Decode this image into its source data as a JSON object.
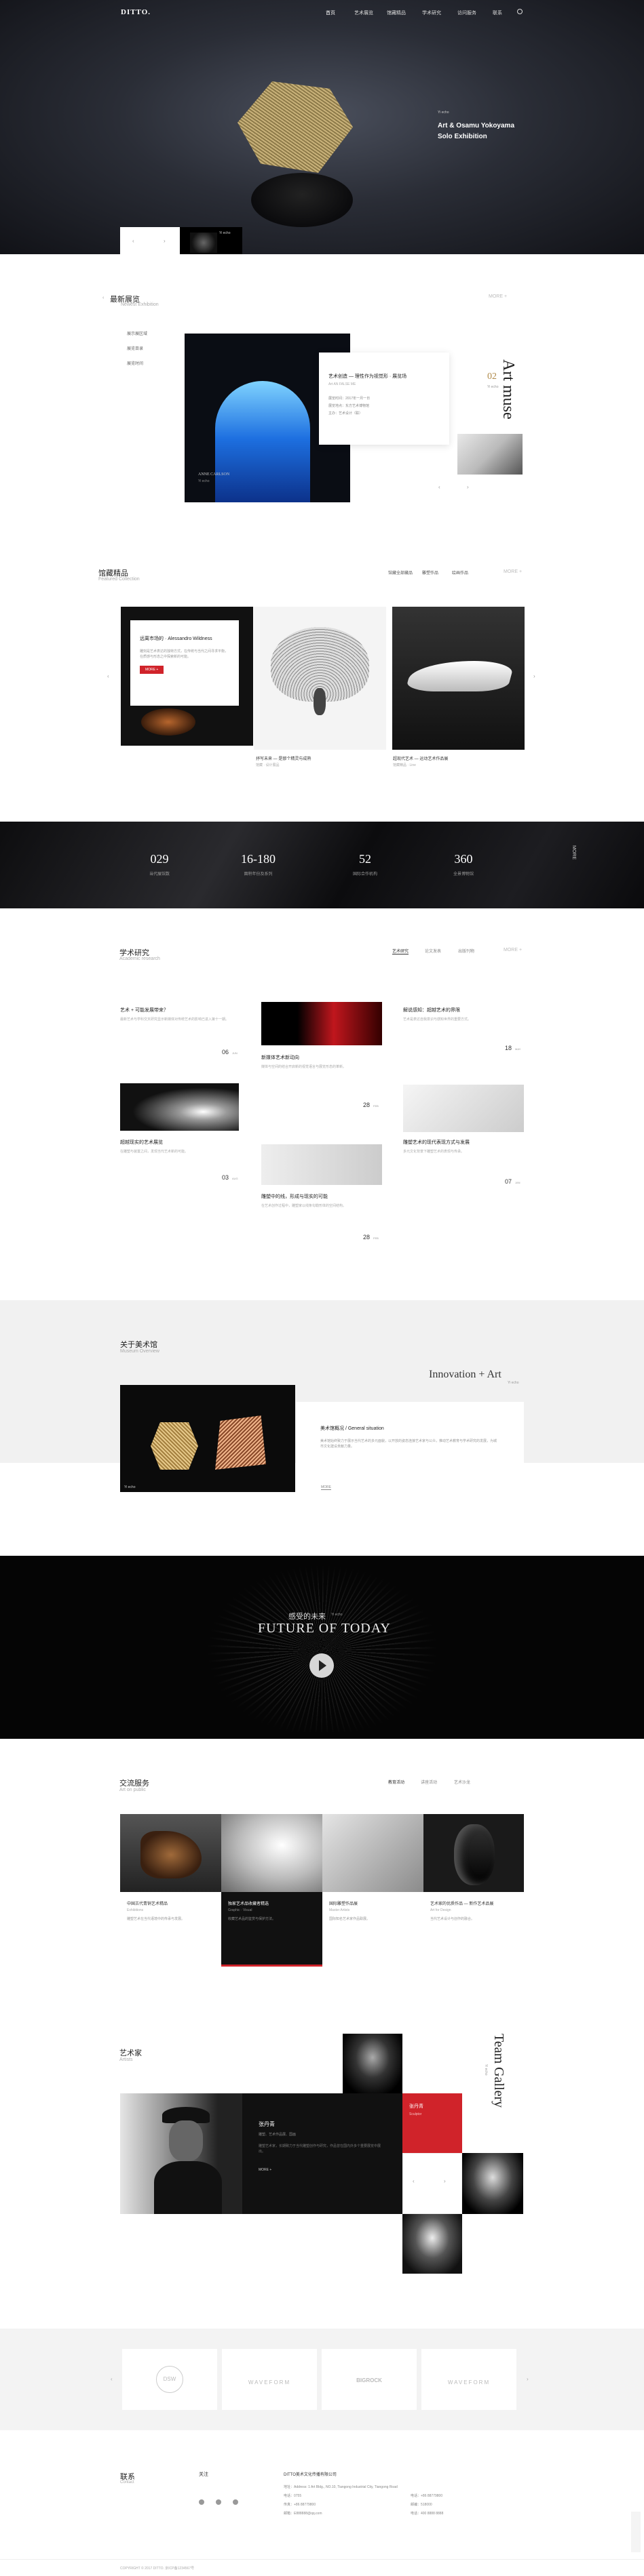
{
  "brand": {
    "logo": "DITTO."
  },
  "nav": {
    "items": [
      "首页",
      "艺术展览",
      "馆藏精品",
      "学术研究",
      "访问服务",
      "联系"
    ],
    "search_icon": "search-icon"
  },
  "hero": {
    "label": "Yi echo",
    "title_line1": "Art & Osamu Yokoyama",
    "title_line2": "Solo Exhibition",
    "thumb_label": "Yi echo"
  },
  "latest": {
    "title": "最新展览",
    "subtitle": "Newest Exhibition",
    "more": "MORE +",
    "list": [
      "展示展区域",
      "展览目录",
      "展览时间"
    ],
    "image_caption1": "ANNE CARLSON",
    "image_caption2": "Yi echo",
    "card_title": "艺术创造 — 理性作为视觉形 · 展览场",
    "card_sub": "Art AN FALSE ME",
    "card_info1": "展览时间：2017年一月一日",
    "card_info2": "展览地点：东方艺术博物馆",
    "card_info3": "主办：艺术设计（联）",
    "muse_title": "Art muse",
    "muse_num": "02",
    "muse_small": "Yi echo"
  },
  "collection": {
    "title": "馆藏精品",
    "subtitle": "Featured Collection",
    "tabs": [
      "馆藏全部藏品",
      "雕塑作品",
      "绘画作品"
    ],
    "more": "MORE +",
    "card1_title": "远离市场的 · Alessandro Wildness",
    "card1_desc": "雕刻是艺术表达的独特方式，在传统与当代之间寻求平衡，在质感与形态之中探索新的可能。",
    "card1_btn": "MORE +",
    "card2_title": "抒写未来 — 是那个精灵与成熟",
    "card2_sub": "馆藏 · 设计展品",
    "card3_title": "超现代艺术 — 运动艺术作品展",
    "card3_sub": "馆藏精品 · Line"
  },
  "stats": [
    {
      "num": "029",
      "label": "当代展馆数"
    },
    {
      "num": "16-180",
      "label": "面积年份及系列"
    },
    {
      "num": "52",
      "label": "国际合作机构"
    },
    {
      "num": "360",
      "label": "全景博物馆"
    }
  ],
  "stats_side": "MORE",
  "research": {
    "title": "学术研究",
    "subtitle": "Academic research",
    "tabs": [
      "艺术研究",
      "论文发表",
      "出版刊物"
    ],
    "more": "MORE +",
    "items": [
      {
        "title": "艺术 + 可能发展带来？",
        "desc": "最新艺术与学科交叉研究显示新媒体对传统艺术的影响已进入第十一期。",
        "date": "06",
        "unit": "JUN"
      },
      {
        "title": "新媒体艺术新动向",
        "desc": "媒体与空间的结合开启新的视觉语言与展览形态的革新。",
        "date": "28",
        "unit": "FEB"
      },
      {
        "title": "解说感知：超越艺术的界限",
        "desc": "艺术是表达自我意识与感知世界的重要方式。",
        "date": "18",
        "unit": "MAY"
      },
      {
        "title": "超越现实的艺术展览",
        "desc": "在雕塑与装置之间，发现当代艺术新的可能。",
        "date": "03",
        "unit": "AUG"
      },
      {
        "title": "雕塑中的线，形成与现实的可能",
        "desc": "在艺术创作过程中，雕塑家以线条勾勒形体的空间结构。",
        "date": "28",
        "unit": "FEB"
      },
      {
        "title": "雕塑艺术的现代表现方式与发展",
        "desc": "多元文化背景下雕塑艺术的表现与传承。",
        "date": "07",
        "unit": "JAN"
      }
    ]
  },
  "about": {
    "title": "关于美术馆",
    "subtitle": "Museum Overview",
    "headline": "Innovation + Art",
    "headline_small": "Yi echo",
    "img_label": "Yi echo",
    "card_title": "美术馆概况 / General situation",
    "card_desc": "美术馆始终致力于展示当代艺术的多元面貌，以开放的姿态连接艺术家与公众，推动艺术教育与学术研究的发展，为城市文化建设贡献力量。",
    "card_more": "MORE"
  },
  "video": {
    "cn": "感受的未来",
    "cn_small": "Yi echo",
    "en": "FUTURE OF TODAY"
  },
  "exchange": {
    "title": "交流服务",
    "subtitle": "Art on public",
    "tabs": [
      "教育活动",
      "讲座活动",
      "艺术沙龙"
    ],
    "items": [
      {
        "title": "中国古代青铜艺术精品",
        "sub": "Exhibitions",
        "desc": "雕塑艺术在当代语境中的传承与发展。"
      },
      {
        "title": "独家艺术品收藏者精选",
        "sub": "Graphic · Visual",
        "desc": "收藏艺术品的鉴赏与保护方法。"
      },
      {
        "title": "国际雕塑作品展",
        "sub": "Master Artists",
        "desc": "国际知名艺术家作品联展。"
      },
      {
        "title": "艺术家的优质作品 — 新作艺术品展",
        "sub": "Art for Design",
        "desc": "当代艺术设计与创作的融合。"
      }
    ]
  },
  "artists": {
    "title": "艺术家",
    "subtitle": "Artists",
    "side_title": "Team Gallery",
    "side_small": "Yi echo",
    "name": "张丹青",
    "role": "雕塑、艺术作品展、国画",
    "desc": "雕塑艺术家，长期致力于当代雕塑创作与研究，作品曾在国内外多个重要展览中展出。",
    "more": "MORE +",
    "red_name": "张丹青",
    "red_role": "Sculptor"
  },
  "partners": [
    "DSW",
    "WAVEFORM",
    "BIGROCK",
    "WAVEFORM"
  ],
  "footer": {
    "title": "联系",
    "subtitle": "Contact",
    "follow": "关注",
    "company": "DITTO美术文化传播有限公司",
    "address": "地址：Address: 1 Art Bldg., NO.10, Tiangong Industrial City, Tiangong Road",
    "tel": "电话：0755",
    "phone1": "电话：+86 88779800",
    "fax": "传真：+86 88779800",
    "zip": "邮编：518000",
    "phone2": "电话：400 8888 8888",
    "email": "邮箱：E888888@qq.com",
    "copyright": "COPYRIGHT © 2017 DITTO. 京ICP备1234567号"
  },
  "colors": {
    "accent": "#d0232a",
    "gold": "#b08a4a",
    "dark": "#111111"
  }
}
